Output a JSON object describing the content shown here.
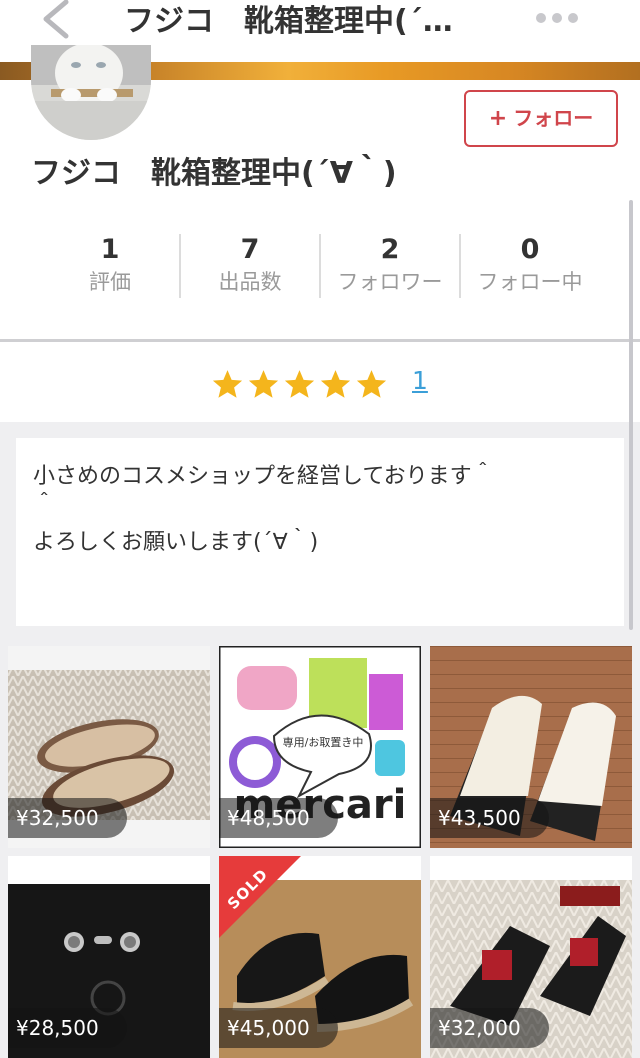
{
  "nav": {
    "title": "フジコ　靴箱整理中(´∀｀)",
    "title_shown": "フジコ　靴箱整理中(´…",
    "back_icon": "chevron-left-icon",
    "more_icon": "more-dots-icon"
  },
  "profile": {
    "name": "フジコ　靴箱整理中(´∀｀)",
    "follow_label": "フォロー",
    "follow_color": "#d0454b"
  },
  "stats": [
    {
      "value": "1",
      "label": "評価"
    },
    {
      "value": "7",
      "label": "出品数"
    },
    {
      "value": "2",
      "label": "フォロワー"
    },
    {
      "value": "0",
      "label": "フォロー中"
    }
  ],
  "rating": {
    "stars": 5,
    "count": "1",
    "star_color": "#f4b51c"
  },
  "bio": {
    "line1": "小さめのコスメショップを経営しております＾",
    "line2": "＾",
    "line3": "よろしくお願いします(´∀｀)"
  },
  "items": [
    {
      "price": "¥32,500",
      "sold": false
    },
    {
      "price": "¥48,500",
      "sold": false,
      "logo_text": "mercari",
      "bubble_text": "専用/お取置き中"
    },
    {
      "price": "¥43,500",
      "sold": false
    },
    {
      "price": "¥28,500",
      "sold": false
    },
    {
      "price": "¥45,000",
      "sold": true,
      "sold_label": "SOLD"
    },
    {
      "price": "¥32,000",
      "sold": false
    }
  ]
}
